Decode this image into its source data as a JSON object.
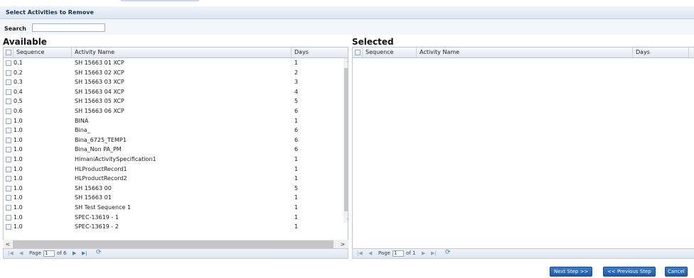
{
  "header": {
    "title": "Select Activities to Remove"
  },
  "search": {
    "label": "Search",
    "value": ""
  },
  "available": {
    "title": "Available",
    "columns": {
      "sequence": "Sequence",
      "name": "Activity Name",
      "days": "Days"
    },
    "rows": [
      {
        "sequence": "0.1",
        "name": "SH 15663 01 XCP",
        "days": "1"
      },
      {
        "sequence": "0.2",
        "name": "SH 15663 02 XCP",
        "days": "2"
      },
      {
        "sequence": "0.3",
        "name": "SH 15663 03 XCP",
        "days": "3"
      },
      {
        "sequence": "0.4",
        "name": "SH 15663 04 XCP",
        "days": "4"
      },
      {
        "sequence": "0.5",
        "name": "SH 15663 05 XCP",
        "days": "5"
      },
      {
        "sequence": "0.6",
        "name": "SH 15663 06 XCP",
        "days": "6"
      },
      {
        "sequence": "1.0",
        "name": "BINA",
        "days": "1"
      },
      {
        "sequence": "1.0",
        "name": "Bina_",
        "days": "6"
      },
      {
        "sequence": "1.0",
        "name": "Bina_6725_TEMP1",
        "days": "6"
      },
      {
        "sequence": "1.0",
        "name": "Bina_Non PA_PM",
        "days": "6"
      },
      {
        "sequence": "1.0",
        "name": "HimaniActivitySpecification1",
        "days": "1"
      },
      {
        "sequence": "1.0",
        "name": "HLProductRecord1",
        "days": "1"
      },
      {
        "sequence": "1.0",
        "name": "HLProductRecord2",
        "days": "1"
      },
      {
        "sequence": "1.0",
        "name": "SH 15663 00",
        "days": "5"
      },
      {
        "sequence": "1.0",
        "name": "SH 15663 01",
        "days": "1"
      },
      {
        "sequence": "1.0",
        "name": "SH Test Sequence 1",
        "days": "1"
      },
      {
        "sequence": "1.0",
        "name": "SPEC-13619 - 1",
        "days": "1"
      },
      {
        "sequence": "1.0",
        "name": "SPEC-13619 - 2",
        "days": "1"
      }
    ],
    "pager": {
      "page_label": "Page",
      "page_value": "1",
      "of_label": "of 6"
    }
  },
  "selected": {
    "title": "Selected",
    "columns": {
      "sequence": "Sequence",
      "name": "Activity Name",
      "days": "Days"
    },
    "pager": {
      "page_label": "Page",
      "page_value": "1",
      "of_label": "of 1"
    }
  },
  "footer": {
    "next_label": "Next Step >>",
    "prev_label": "<< Previous Step",
    "cancel_label": "Cancel"
  },
  "icons": {
    "first": "first-page-icon",
    "prev": "prev-page-icon",
    "next": "next-page-icon",
    "last": "last-page-icon",
    "refresh": "refresh-icon"
  },
  "colors": {
    "accent": "#1d5aa6",
    "header_bg": "#dde6f1"
  }
}
